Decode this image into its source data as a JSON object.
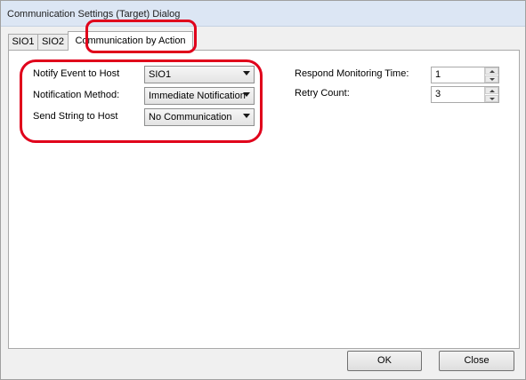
{
  "window": {
    "title": "Communication Settings (Target) Dialog"
  },
  "tabs": [
    {
      "label": "SIO1"
    },
    {
      "label": "SIO2"
    },
    {
      "label": "Communication by Action"
    }
  ],
  "form": {
    "notify_event_label": "Notify Event to Host",
    "notify_event_value": "SIO1",
    "notification_method_label": "Notification Method:",
    "notification_method_value": "Immediate Notification",
    "send_string_label": "Send String to Host",
    "send_string_value": "No Communication",
    "respond_time_label": "Respond Monitoring Time:",
    "respond_time_value": "1",
    "retry_count_label": "Retry Count:",
    "retry_count_value": "3"
  },
  "buttons": {
    "ok": "OK",
    "close": "Close"
  },
  "colors": {
    "highlight": "#e0001b",
    "titlebar": "#dce6f4"
  }
}
